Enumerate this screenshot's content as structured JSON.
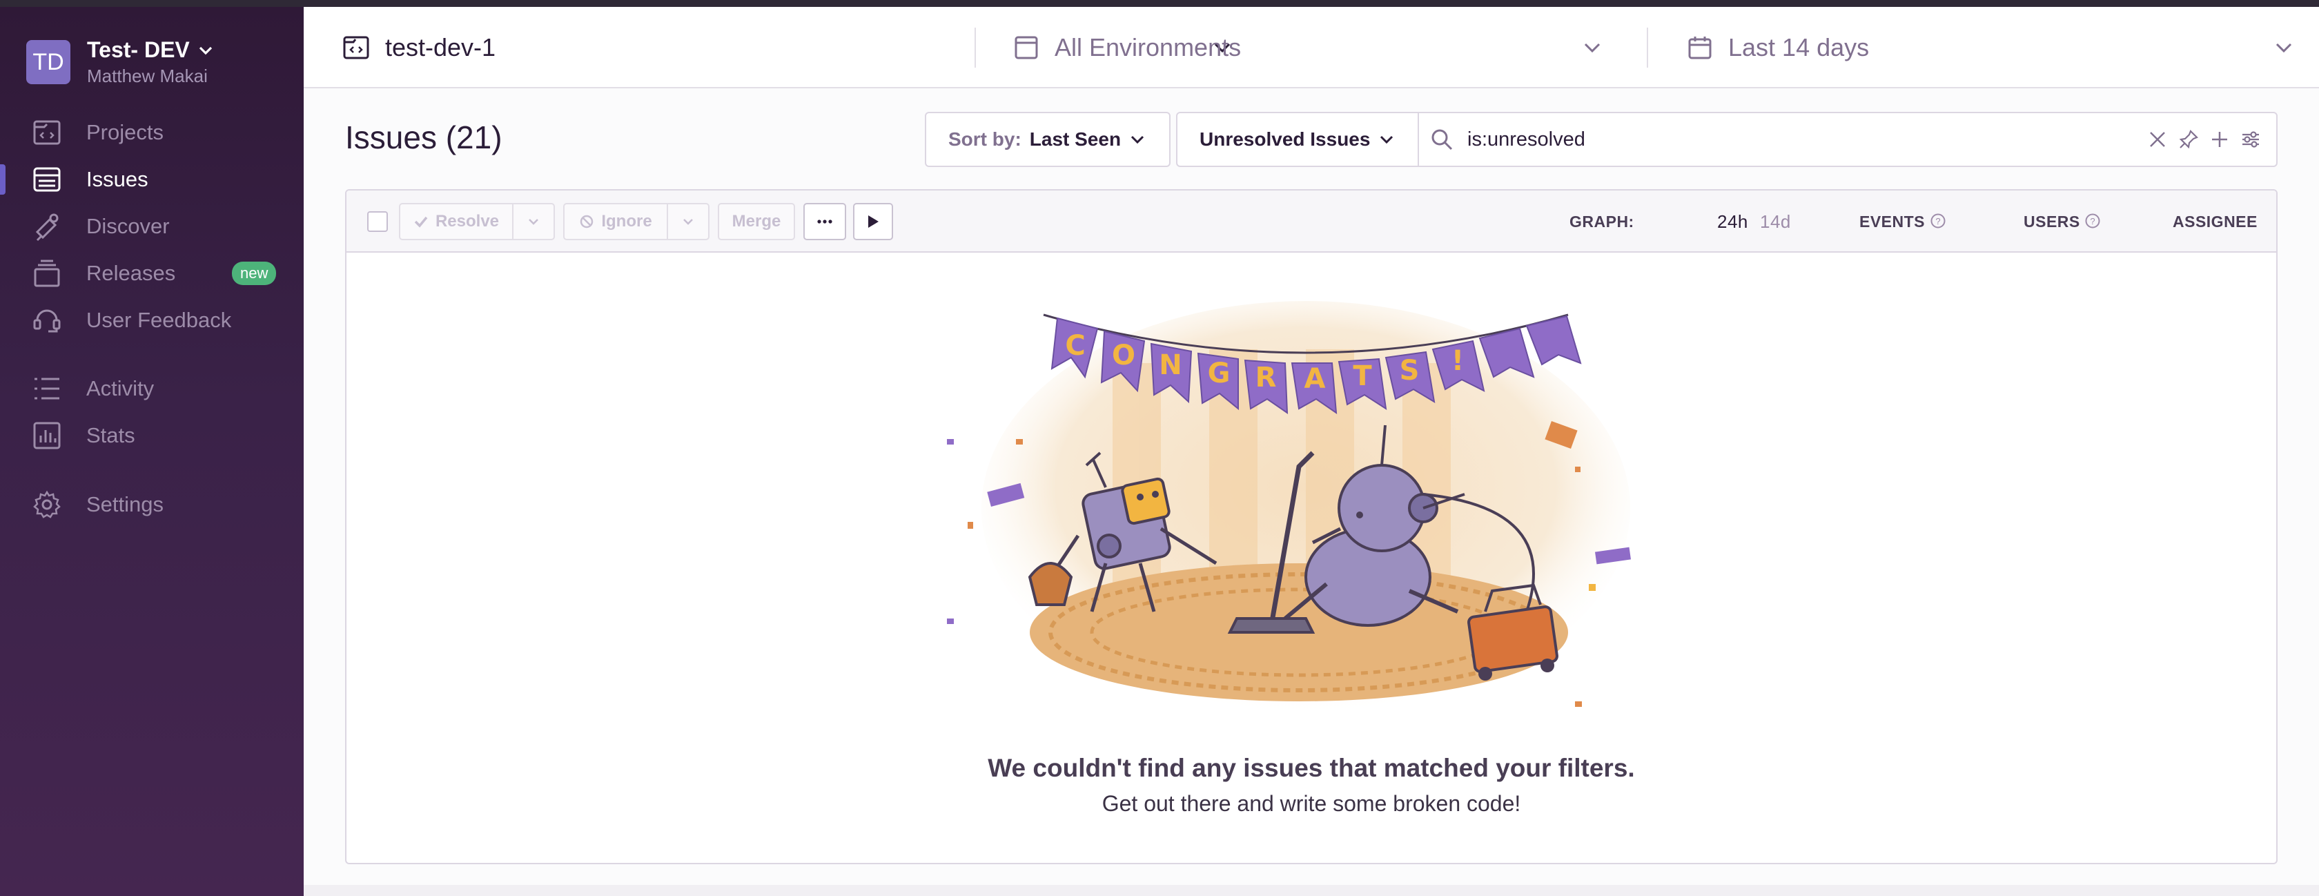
{
  "org": {
    "initials": "TD",
    "name": "Test- DEV",
    "user": "Matthew Makai"
  },
  "sidebar": {
    "items": [
      {
        "label": "Projects",
        "icon": "projects-icon"
      },
      {
        "label": "Issues",
        "icon": "issues-icon",
        "active": true
      },
      {
        "label": "Discover",
        "icon": "discover-icon"
      },
      {
        "label": "Releases",
        "icon": "releases-icon",
        "badge": "new"
      },
      {
        "label": "User Feedback",
        "icon": "user-feedback-icon"
      },
      {
        "label": "Activity",
        "icon": "activity-icon"
      },
      {
        "label": "Stats",
        "icon": "stats-icon"
      },
      {
        "label": "Settings",
        "icon": "settings-icon"
      }
    ]
  },
  "header": {
    "project": "test-dev-1",
    "environment": "All Environments",
    "date_range": "Last 14 days"
  },
  "issues": {
    "title": "Issues",
    "count": "(21)",
    "sort_label": "Sort by:",
    "sort_value": "Last Seen",
    "saved_search": "Unresolved Issues",
    "search_query": "is:unresolved"
  },
  "toolbar": {
    "resolve": "Resolve",
    "ignore": "Ignore",
    "merge": "Merge",
    "graph_label": "GRAPH:",
    "graph_24h": "24h",
    "graph_14d": "14d",
    "events": "EVENTS",
    "users": "USERS",
    "assignee": "ASSIGNEE"
  },
  "empty_state": {
    "banner": "CONGRATS!",
    "title": "We couldn't find any issues that matched your filters.",
    "subtitle": "Get out there and write some broken code!"
  },
  "colors": {
    "sidebar_top": "#2f1937",
    "accent": "#6c5fc7",
    "badge_green": "#4db37a",
    "banner_purple": "#8f6cc7",
    "banner_letters": "#f2b541"
  }
}
